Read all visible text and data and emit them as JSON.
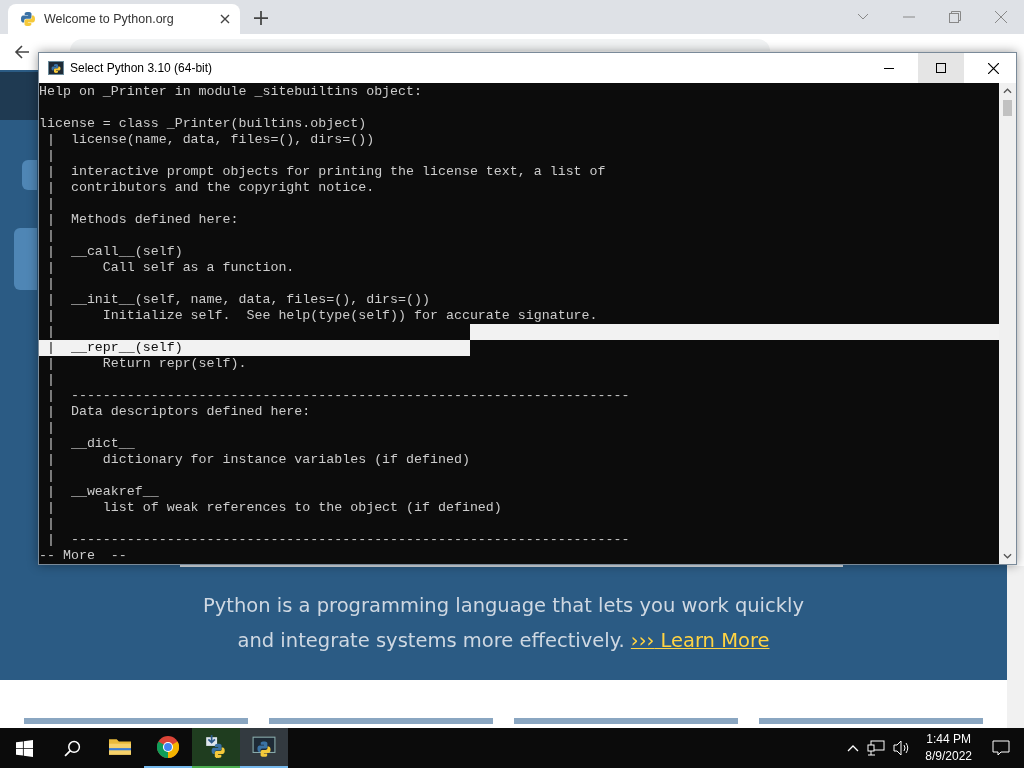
{
  "browser": {
    "tab": {
      "title": "Welcome to Python.org",
      "selected": true
    }
  },
  "page": {
    "intro_line_1": "Python is a programming language that lets you work quickly",
    "intro_line_2": "and integrate systems more effectively.",
    "link_arrow": "›››",
    "link": "Learn More"
  },
  "console": {
    "title": "Select Python 3.10 (64-bit)",
    "lines": [
      {
        "text": "Help on _Printer in module _sitebuiltins object:",
        "selected": false
      },
      {
        "selected": false
      },
      {
        "text": "license = class _Printer(builtins.object)",
        "selected": false
      },
      {
        "text": " |  license(name, data, files=(), dirs=())",
        "selected": false
      },
      {
        "text": " |",
        "selected": false
      },
      {
        "text": " |  interactive prompt objects for printing the license text, a list of",
        "selected": false
      },
      {
        "text": " |  contributors and the copyright notice.",
        "selected": false
      },
      {
        "text": " |",
        "selected": false
      },
      {
        "text": " |  Methods defined here:",
        "selected": false
      },
      {
        "text": " |",
        "selected": false
      },
      {
        "text": " |  __call__(self)",
        "selected": false
      },
      {
        "text": " |      Call self as a function.",
        "selected": false
      },
      {
        "text": " |",
        "selected": false
      },
      {
        "text": " |  __init__(self, name, data, files=(), dirs=())",
        "selected": false
      },
      {
        "text": " |      Initialize self.  See help(type(self)) for accurate signature.",
        "selected": false
      },
      {
        "text": " |",
        "selected": true
      },
      {
        "text": " |  __repr__(self)",
        "selected": true
      },
      {
        "text": " |      Return repr(self).",
        "selected": false
      },
      {
        "text": " |",
        "selected": false
      },
      {
        "text": " |  ----------------------------------------------------------------------",
        "selected": false
      },
      {
        "text": " |  Data descriptors defined here:",
        "selected": false
      },
      {
        "text": " |",
        "selected": false
      },
      {
        "text": " |  __dict__",
        "selected": false
      },
      {
        "text": " |      dictionary for instance variables (if defined)",
        "selected": false
      },
      {
        "text": " |",
        "selected": false
      },
      {
        "text": " |  __weakref__",
        "selected": false
      },
      {
        "text": " |      list of weak references to the object (if defined)",
        "selected": false
      },
      {
        "text": " |",
        "selected": false
      },
      {
        "text": " |  ----------------------------------------------------------------------",
        "selected": false
      },
      {
        "text": "-- More  --",
        "selected": false
      }
    ]
  },
  "taskbar": {
    "apps": [
      {
        "kind": "folder",
        "running": false,
        "active": false
      },
      {
        "kind": "chrome",
        "running": true,
        "active": false
      },
      {
        "kind": "python-setup",
        "running": true,
        "active": false
      },
      {
        "kind": "python-console",
        "running": true,
        "active": true
      }
    ],
    "time": "1:44 PM",
    "date": "8/9/2022"
  }
}
